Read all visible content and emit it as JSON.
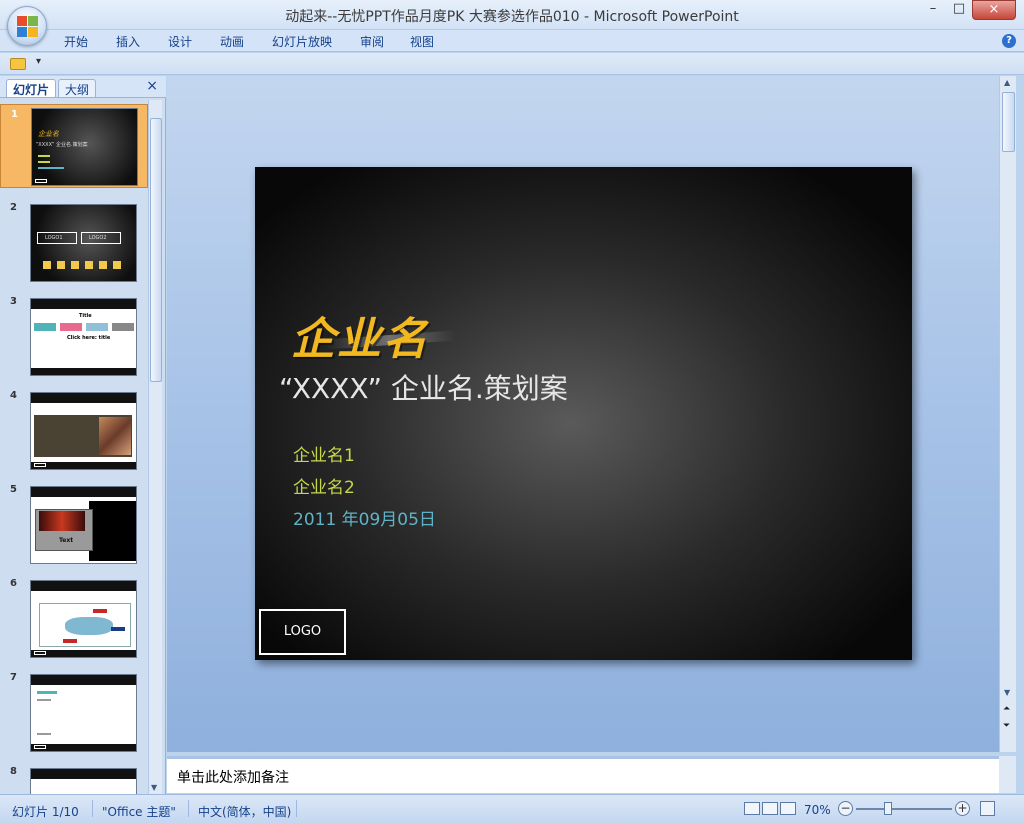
{
  "window": {
    "title": "动起来--无忧PPT作品月度PK 大赛参选作品010 - Microsoft PowerPoint",
    "minimize": "–",
    "maximize": "□",
    "close": "×"
  },
  "ribbon": {
    "tabs": [
      "开始",
      "插入",
      "设计",
      "动画",
      "幻灯片放映",
      "审阅",
      "视图"
    ],
    "help": "?"
  },
  "qat": {
    "dropdown": "▾"
  },
  "pane": {
    "tabs": {
      "active": "幻灯片",
      "other": "大纲"
    },
    "close": "×",
    "thumbnails": [
      {
        "num": "1",
        "selected": true
      },
      {
        "num": "2"
      },
      {
        "num": "3"
      },
      {
        "num": "4"
      },
      {
        "num": "5"
      },
      {
        "num": "6"
      },
      {
        "num": "7"
      },
      {
        "num": "8"
      }
    ],
    "thumb_text": {
      "t1_title": "企业名",
      "t1_sub": "“XXXX” 企业名.策划案",
      "t2_logo1": "LOGO1",
      "t2_logo2": "LOGO2",
      "t3_title": "Title",
      "t3_click": "Click here: title",
      "t5_text": "Text"
    }
  },
  "slide": {
    "company": "企业名",
    "subtitle": "“XXXX” 企业名.策划案",
    "line1": "企业名1",
    "line2": "企业名2",
    "date": "2011 年09月05日",
    "logo": "LOGO",
    "colors": {
      "company": "#f2b820",
      "lines": "#c6d84a",
      "date": "#5fb3c8"
    }
  },
  "notes": {
    "placeholder": "单击此处添加备注"
  },
  "status": {
    "slide_counter": "幻灯片 1/10",
    "theme": "\"Office 主题\"",
    "language": "中文(简体，中国)",
    "zoom": "70%",
    "zoom_out": "−",
    "zoom_in": "+"
  }
}
